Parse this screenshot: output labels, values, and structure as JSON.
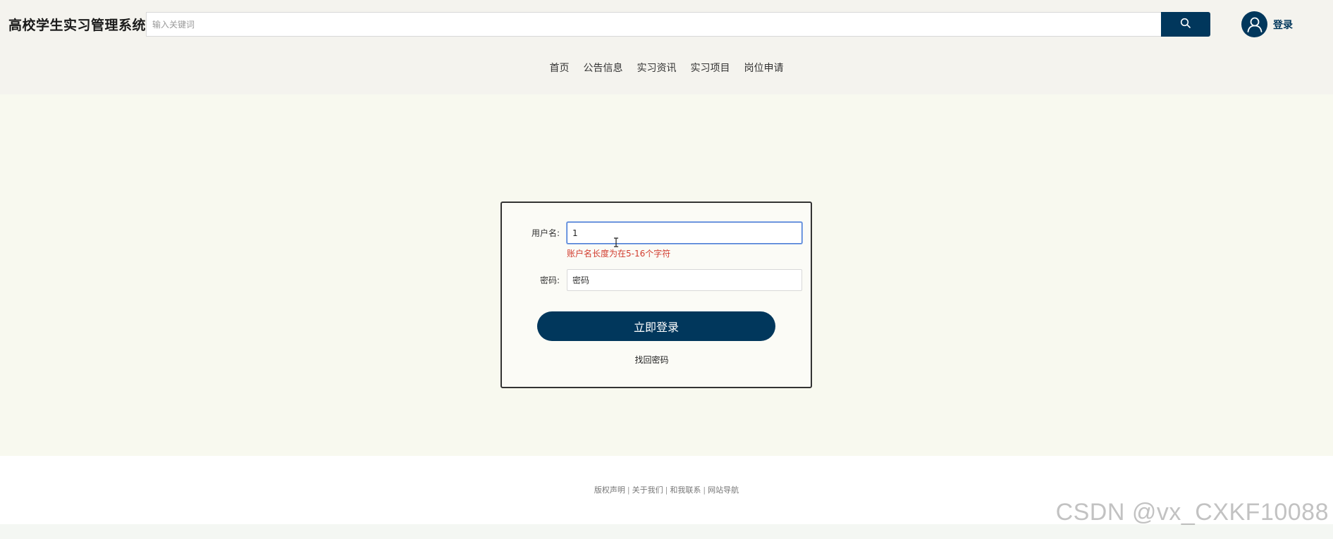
{
  "header": {
    "site_title": "高校学生实习管理系统",
    "search": {
      "placeholder": "输入关键词",
      "value": ""
    },
    "search_icon": "search-icon",
    "user_icon": "user-icon",
    "login_label": "登录"
  },
  "nav": {
    "items": [
      {
        "label": "首页"
      },
      {
        "label": "公告信息"
      },
      {
        "label": "实习资讯"
      },
      {
        "label": "实习项目"
      },
      {
        "label": "岗位申请"
      }
    ]
  },
  "login_form": {
    "username_label": "用户名:",
    "username_value": "1",
    "username_error": "账户名长度为在5-16个字符",
    "password_label": "密码:",
    "password_placeholder": "密码",
    "submit_label": "立即登录",
    "forgot_label": "找回密码"
  },
  "footer": {
    "links": [
      "版权声明",
      "关于我们",
      "和我联系",
      "网站导航"
    ],
    "separator": "|"
  },
  "watermark": "CSDN @vx_CXKF10088",
  "colors": {
    "brand": "#01375c",
    "error": "#d23c2e",
    "header_bg": "#f4f3ee",
    "main_bg": "#f8f9ef"
  }
}
